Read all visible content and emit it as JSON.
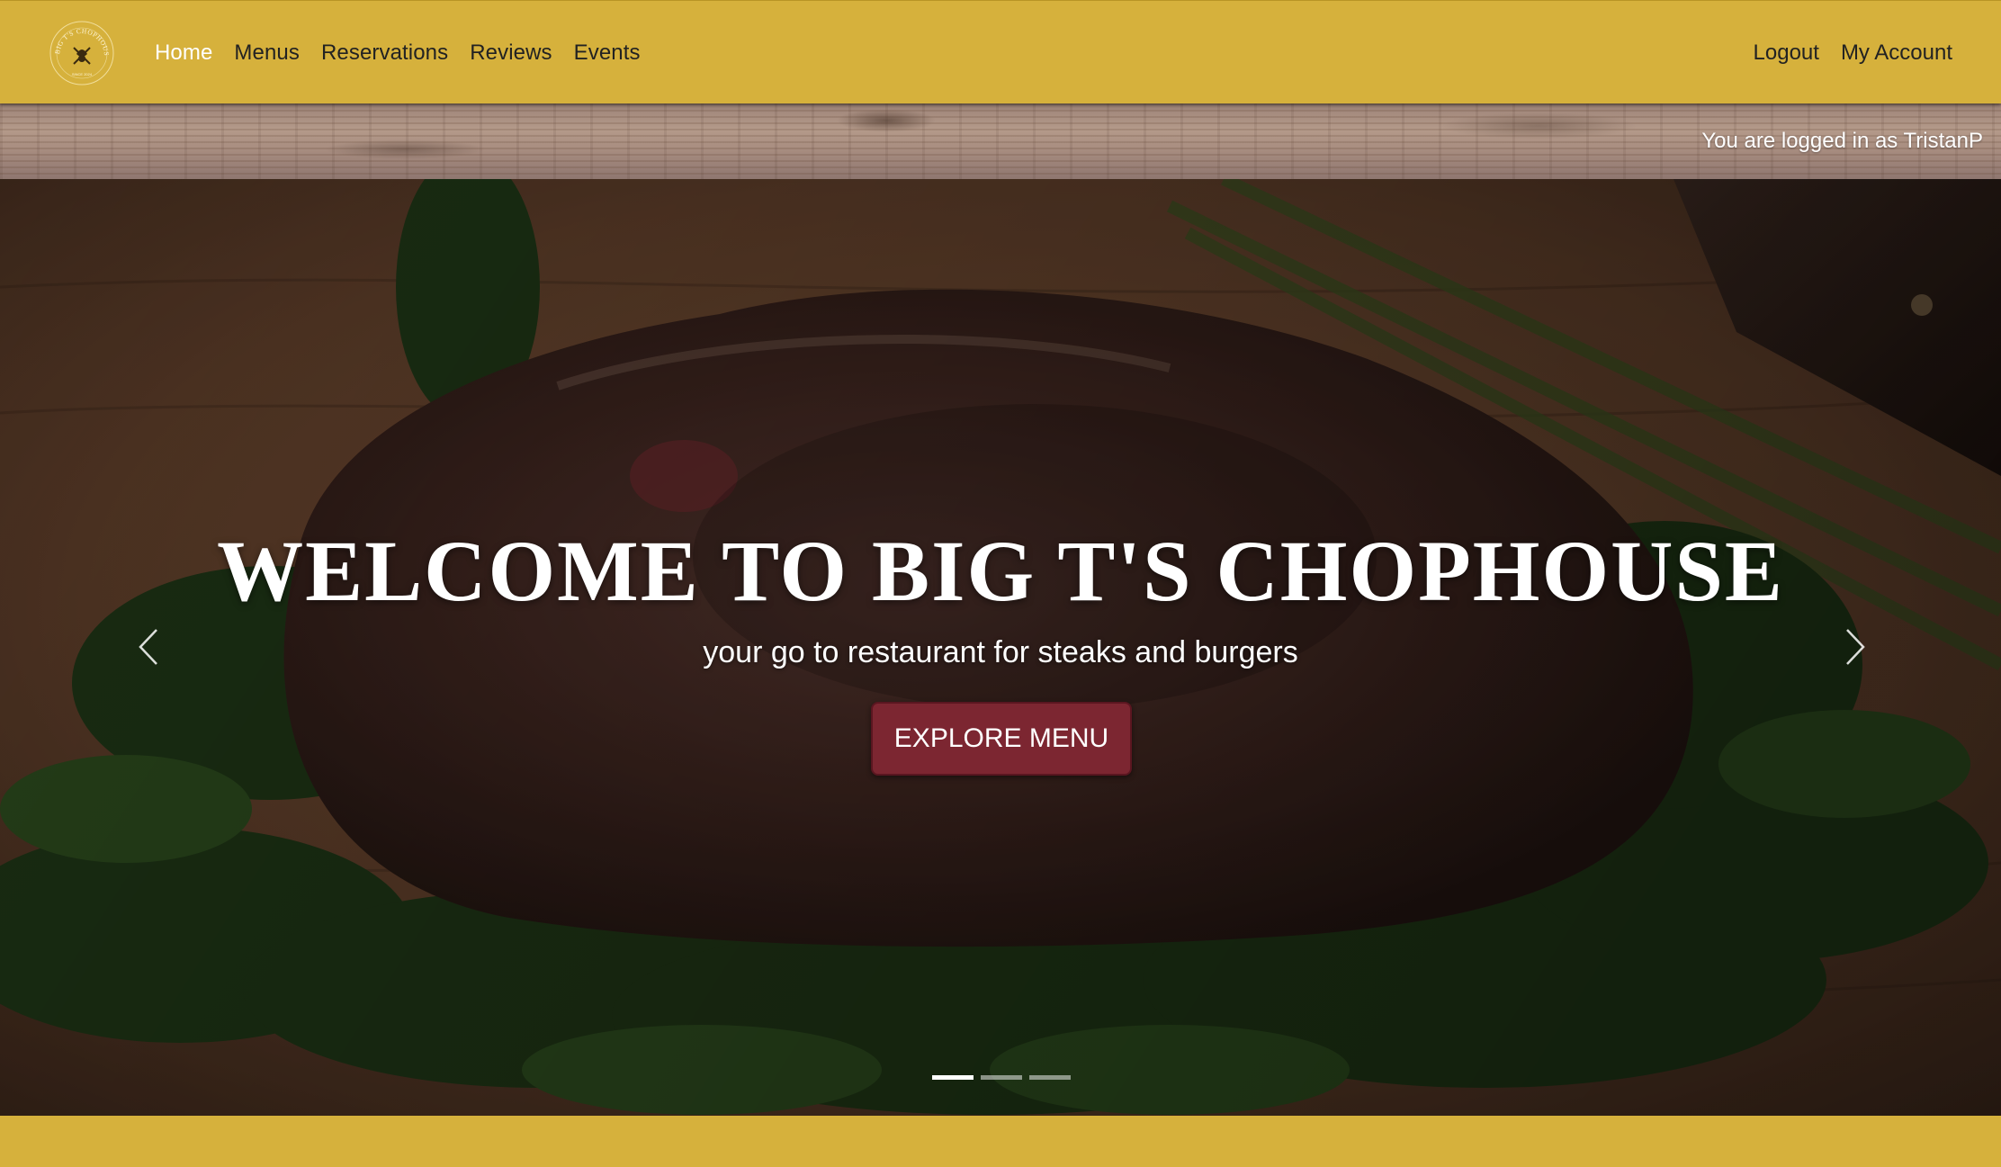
{
  "brand": {
    "logo_text": "BIG T'S CHOPHOUSE",
    "logo_since": "SINCE 2024"
  },
  "nav": {
    "items": [
      {
        "label": "Home",
        "active": true
      },
      {
        "label": "Menus",
        "active": false
      },
      {
        "label": "Reservations",
        "active": false
      },
      {
        "label": "Reviews",
        "active": false
      },
      {
        "label": "Events",
        "active": false
      }
    ],
    "logout_label": "Logout",
    "account_label": "My Account"
  },
  "session": {
    "status_text": "You are logged in as TristanP"
  },
  "hero": {
    "title": "WELCOME TO BIG T'S CHOPHOUSE",
    "subtitle": "your go to restaurant for steaks and burgers",
    "cta_label": "EXPLORE MENU",
    "prev_icon": "chevron-left-icon",
    "next_icon": "chevron-right-icon",
    "slide_count": 3,
    "active_slide": 1
  },
  "colors": {
    "navbar": "#d6b13c",
    "cta": "#7c2631",
    "nav_active": "#ffffff",
    "nav_text": "#222222"
  }
}
